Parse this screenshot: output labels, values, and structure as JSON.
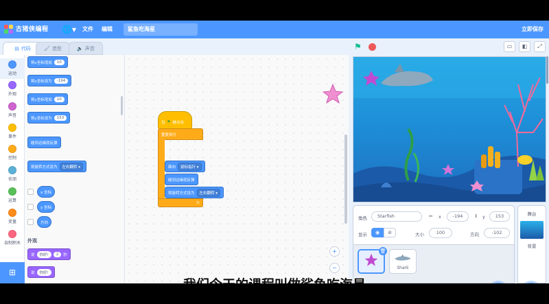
{
  "menubar": {
    "logo_text": "古猪侠编程",
    "file": "文件",
    "edit": "编辑",
    "project_title": "鲨鱼吃海星",
    "save_now": "立即保存",
    "globe_icon": "globe-icon"
  },
  "tabs": [
    {
      "label": "代码",
      "icon": "code-icon"
    },
    {
      "label": "造型",
      "icon": "brush-icon"
    },
    {
      "label": "声音",
      "icon": "speaker-icon"
    }
  ],
  "categories": [
    {
      "label": "运动",
      "color": "#4c97ff"
    },
    {
      "label": "外观",
      "color": "#9966ff"
    },
    {
      "label": "声音",
      "color": "#cf63cf"
    },
    {
      "label": "事件",
      "color": "#ffbf00"
    },
    {
      "label": "控制",
      "color": "#ffab19"
    },
    {
      "label": "侦测",
      "color": "#5cb1d6"
    },
    {
      "label": "运算",
      "color": "#59c059"
    },
    {
      "label": "变量",
      "color": "#ff8c1a"
    },
    {
      "label": "自制积木",
      "color": "#ff6680"
    }
  ],
  "palette": {
    "blocks": [
      {
        "text": "将x坐标增加",
        "value": "10"
      },
      {
        "text": "将x坐标设为",
        "value": "-194"
      },
      {
        "text": "将y坐标增加",
        "value": "10"
      },
      {
        "text": "将y坐标设为",
        "value": "153"
      },
      {
        "text": "碰到边缘就反弹"
      },
      {
        "text": "将旋转方式设为",
        "dropdown": "左右翻转"
      }
    ],
    "reporters": [
      "x 坐标",
      "y 坐标",
      "方向"
    ],
    "looks_section": "外观",
    "looks_blocks": [
      {
        "prefix": "说",
        "value": "你好!",
        "value2": "2",
        "suffix": "秒"
      },
      {
        "prefix": "说",
        "value": "你好!"
      }
    ]
  },
  "script": {
    "hat": "当",
    "hat_suffix": "被点击",
    "forever": "重复执行",
    "point_towards": "面向",
    "point_target": "鼠标指针",
    "bounce": "碰到边缘就反弹",
    "rotation": "将旋转方式设为",
    "rotation_value": "左右翻转"
  },
  "sprite_info": {
    "sprite_label": "角色",
    "sprite_name": "Starfish",
    "x": "-194",
    "y": "153",
    "show_label": "显示",
    "size_label": "大小",
    "size": "100",
    "direction_label": "方向",
    "direction": "-102"
  },
  "sprites": [
    {
      "name": "Starfish",
      "selected": true
    },
    {
      "name": "Shark",
      "selected": false
    }
  ],
  "stage_panel": {
    "title": "舞台",
    "backdrops_label": "背景"
  },
  "subtitle": "我们今天的课程叫做鲨鱼吃海星"
}
